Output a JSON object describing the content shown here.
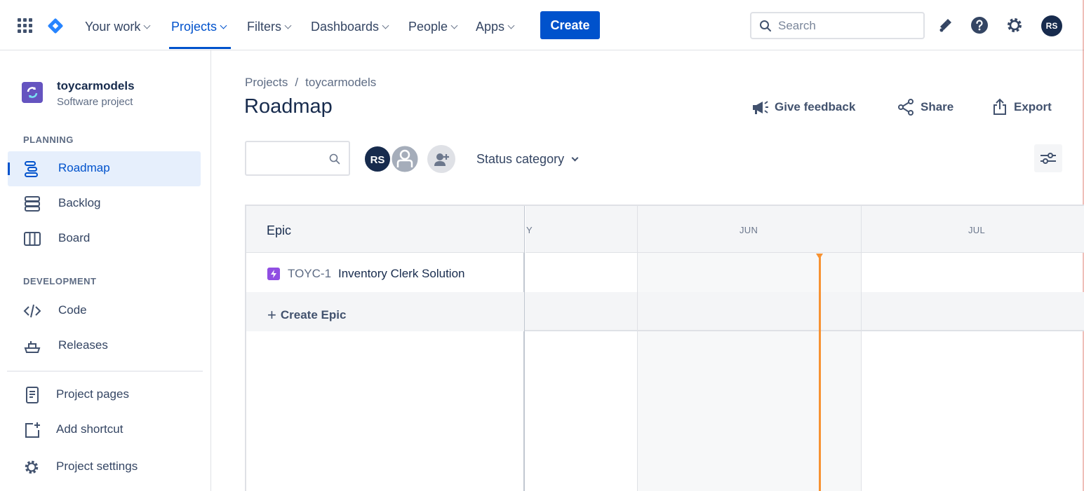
{
  "topnav": {
    "items": [
      {
        "label": "Your work"
      },
      {
        "label": "Projects",
        "active": true
      },
      {
        "label": "Filters"
      },
      {
        "label": "Dashboards"
      },
      {
        "label": "People"
      },
      {
        "label": "Apps"
      }
    ],
    "create_label": "Create",
    "search_placeholder": "Search",
    "user_initials": "RS",
    "icons": [
      "app-switcher-icon",
      "jira-logo-icon",
      "notifications-icon",
      "help-icon",
      "settings-icon"
    ],
    "accent_color": "#0052cc"
  },
  "sidebar": {
    "project_name": "toycarmodels",
    "project_type": "Software project",
    "planning_label": "PLANNING",
    "planning_items": [
      {
        "label": "Roadmap",
        "icon": "roadmap-icon",
        "active": true
      },
      {
        "label": "Backlog",
        "icon": "backlog-icon"
      },
      {
        "label": "Board",
        "icon": "board-icon"
      }
    ],
    "development_label": "DEVELOPMENT",
    "development_items": [
      {
        "label": "Code",
        "icon": "code-icon"
      },
      {
        "label": "Releases",
        "icon": "releases-icon"
      }
    ],
    "footer_items": [
      {
        "label": "Project pages",
        "icon": "project-pages-icon"
      },
      {
        "label": "Add shortcut",
        "icon": "add-shortcut-icon"
      },
      {
        "label": "Project settings",
        "icon": "project-settings-icon"
      }
    ]
  },
  "main": {
    "breadcrumb": [
      "Projects",
      "toycarmodels"
    ],
    "breadcrumb_sep": "/",
    "title": "Roadmap",
    "actions": {
      "feedback": "Give feedback",
      "share": "Share",
      "export": "Export"
    },
    "filters": {
      "search_value": "",
      "avatar_initials": "RS",
      "status_category": "Status category"
    },
    "roadmap": {
      "epic_header": "Epic",
      "months": [
        "Y",
        "JUN",
        "JUL"
      ],
      "epics": [
        {
          "key": "TOYC-1",
          "summary": "Inventory Clerk Solution",
          "color": "#904ee2"
        }
      ],
      "create_epic": "Create Epic",
      "today_color": "#f79232"
    }
  }
}
